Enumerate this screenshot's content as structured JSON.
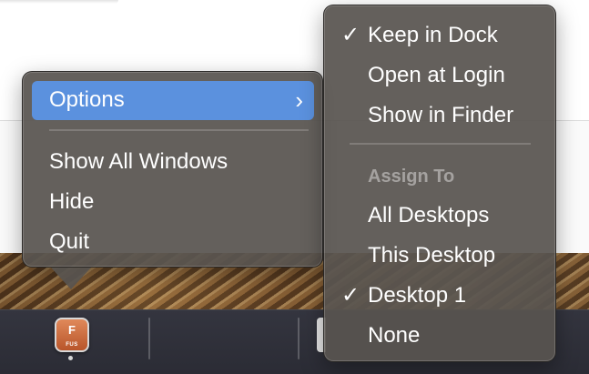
{
  "main_menu": {
    "options_label": "Options",
    "options_arrow": "›",
    "items": [
      "Show All Windows",
      "Hide",
      "Quit"
    ]
  },
  "submenu": {
    "group1": [
      {
        "label": "Keep in Dock",
        "checked": "✓"
      },
      {
        "label": "Open at Login",
        "checked": ""
      },
      {
        "label": "Show in Finder",
        "checked": ""
      }
    ],
    "assign_header": "Assign To",
    "group2": [
      {
        "label": "All Desktops",
        "checked": ""
      },
      {
        "label": "This Desktop",
        "checked": ""
      },
      {
        "label": "Desktop 1",
        "checked": "✓"
      },
      {
        "label": "None",
        "checked": ""
      }
    ]
  },
  "dock": {
    "app_letter": "F",
    "app_sub": "FUS",
    "app_icon": "fusion-app-icon"
  },
  "colors": {
    "menu_bg": "#58544f",
    "highlight": "#5b91de",
    "dock_bg": "#2b2c35"
  }
}
